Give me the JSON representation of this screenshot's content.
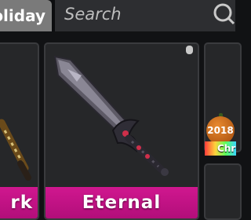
{
  "header": {
    "tab_label": "oliday",
    "search_placeholder": "Search"
  },
  "inventory": {
    "items": [
      {
        "label": "rk",
        "rarity_color": "#c8158a"
      },
      {
        "label": "Eternal",
        "rarity_color": "#c8158a"
      }
    ],
    "partial_item": {
      "badge_text": "2018",
      "tag_text": "Chr"
    }
  },
  "icons": [
    "search-icon",
    "knife-icon",
    "sword-icon",
    "pumpkin-icon"
  ]
}
